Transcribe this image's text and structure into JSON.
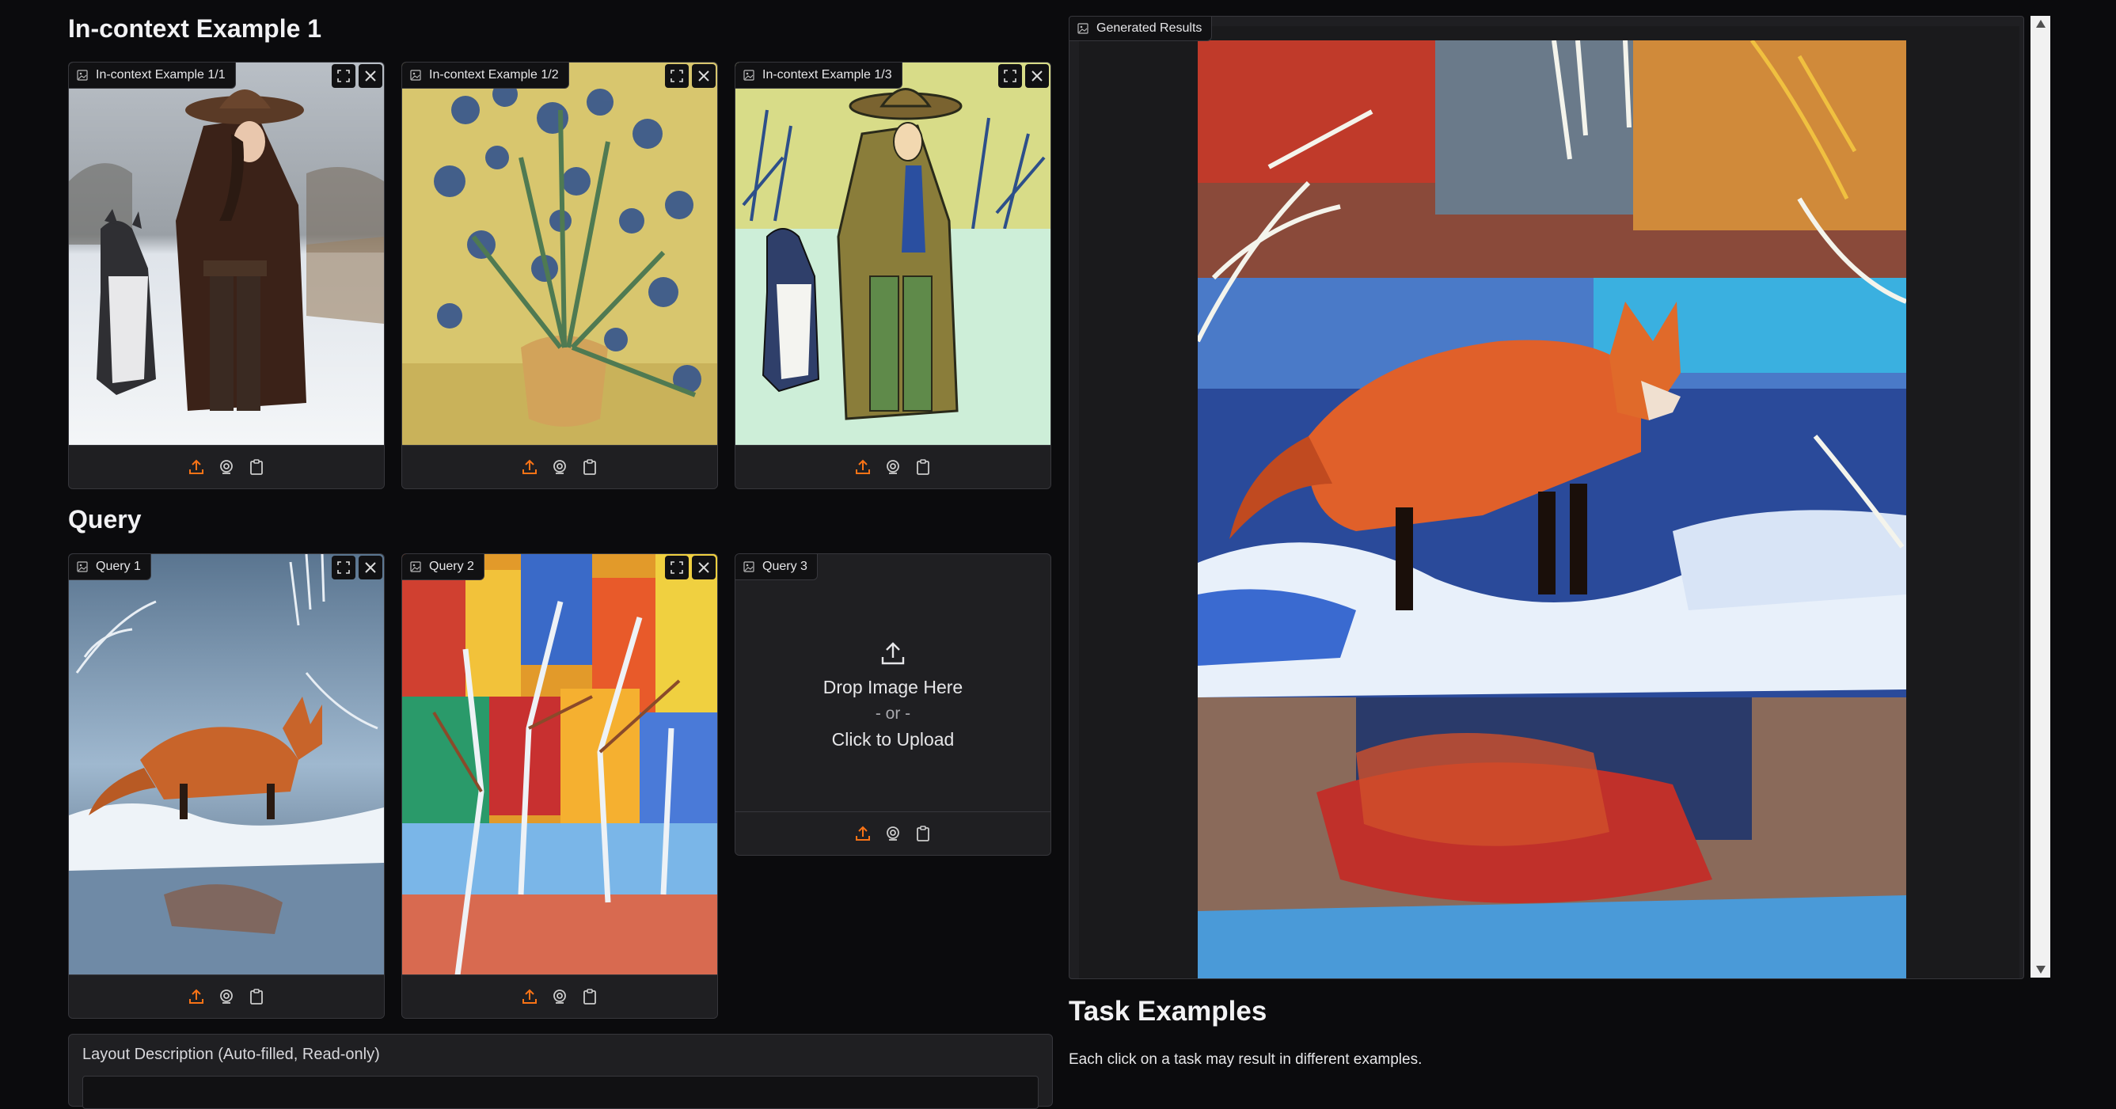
{
  "incontext": {
    "title": "In-context Example 1",
    "images": [
      {
        "label": "In-context Example 1/1"
      },
      {
        "label": "In-context Example 1/2"
      },
      {
        "label": "In-context Example 1/3"
      }
    ]
  },
  "query": {
    "title": "Query",
    "images": [
      {
        "label": "Query 1"
      },
      {
        "label": "Query 2"
      },
      {
        "label": "Query 3"
      }
    ],
    "dropzone": {
      "line1": "Drop Image Here",
      "line2": "- or -",
      "line3": "Click to Upload"
    }
  },
  "generated": {
    "label": "Generated Results"
  },
  "layout_description": {
    "label": "Layout Description (Auto-filled, Read-only)",
    "value": ""
  },
  "task_examples": {
    "title": "Task Examples",
    "description": "Each click on a task may result in different examples."
  },
  "colors": {
    "accent": "#f97316",
    "background": "#0b0b0d",
    "panel": "#1f1f22",
    "border": "#37373c"
  },
  "icons": [
    "image-icon",
    "fullscreen-icon",
    "close-icon",
    "upload-icon",
    "webcam-icon",
    "clipboard-icon",
    "scroll-up-icon",
    "scroll-down-icon"
  ]
}
